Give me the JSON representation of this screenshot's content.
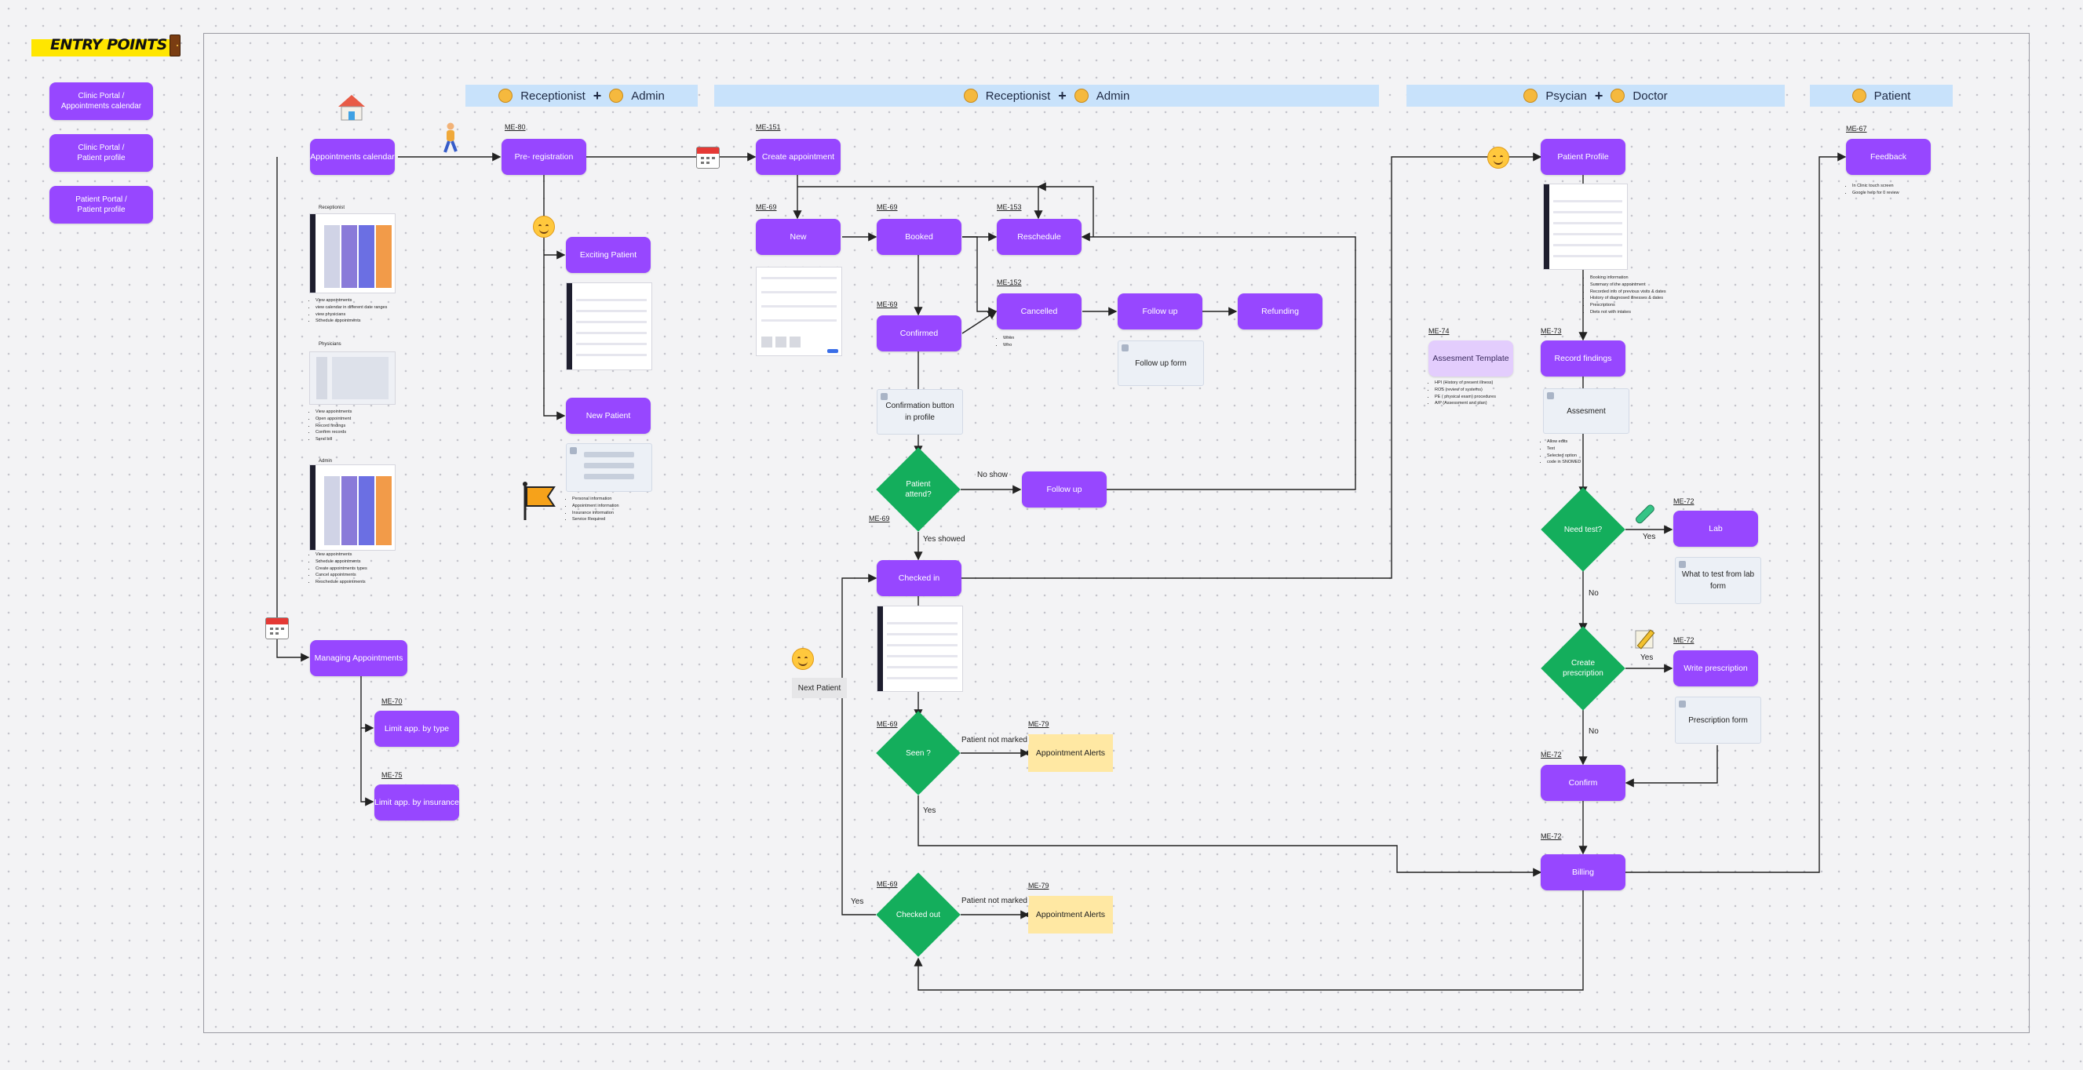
{
  "header": {
    "title": "ENTRY POINTS"
  },
  "entry_points": [
    "Clinic Portal /\nAppointments calendar",
    "Clinic Portal /\nPatient profile",
    "Patient Portal /\nPatient profile"
  ],
  "lanes": {
    "lane1": {
      "a": "Receptionist",
      "b": "Admin"
    },
    "lane2": {
      "a": "Receptionist",
      "b": "Admin"
    },
    "lane3": {
      "a": "Psycian",
      "b": "Doctor"
    },
    "lane4": {
      "a": "Patient"
    }
  },
  "nodes": {
    "appointments_calendar": "Appointments calendar",
    "pre_registration": "Pre- registration",
    "create_appointment": "Create appointment",
    "patient_profile": "Patient Profile",
    "feedback": "Feedback",
    "new": "New",
    "booked": "Booked",
    "reschedule": "Reschedule",
    "existing_patient": "Exciting Patient",
    "new_patient": "New Patient",
    "confirmed": "Confirmed",
    "cancelled": "Cancelled",
    "follow_up_a": "Follow up",
    "refunding": "Refunding",
    "follow_up_b": "Follow up",
    "checked_in": "Checked in",
    "managing_appointments": "Managing Appointments",
    "limit_by_type": "Limit app. by type",
    "limit_by_insurance": "Limit app. by insurance",
    "assessment_template": "Assesment Template",
    "record_findings": "Record findings",
    "lab": "Lab",
    "write_prescription": "Write prescription",
    "confirm": "Confirm",
    "billing": "Billing",
    "appointment_alerts_1": "Appointment Alerts",
    "appointment_alerts_2": "Appointment Alerts",
    "next_patient": "Next Patient"
  },
  "decisions": {
    "patient_attend": "Patient\nattend?",
    "seen": "Seen ?",
    "checked_out": "Checked out",
    "need_test": "Need test?",
    "create_prescription": "Create\nprescription"
  },
  "ids": {
    "me80": "ME-80",
    "me151": "ME-151",
    "me69a": "ME-69",
    "me69b": "ME-69",
    "me153": "ME-153",
    "me152": "ME-152",
    "me69c": "ME-69",
    "me69d": "ME-69",
    "me69e": "ME-69",
    "me79a": "ME-79",
    "me69f": "ME-69",
    "me79b": "ME-79",
    "me70": "ME-70",
    "me75": "ME-75",
    "me67": "ME-67",
    "me74": "ME-74",
    "me73": "ME-73",
    "me72a": "ME-72",
    "me72b": "ME-72",
    "me72c": "ME-72",
    "me72d": "ME-72"
  },
  "edge_labels": {
    "no_show": "No show",
    "yes_showed": "Yes showed",
    "not_marked_1": "Patient not marked",
    "yes_seen": "Yes",
    "not_marked_2": "Patient not marked",
    "yes_out": "Yes",
    "yes_test": "Yes",
    "no_test": "No",
    "yes_presc": "Yes",
    "no_presc": "No"
  },
  "forms": {
    "follow_up_form": "Follow up form",
    "confirmation_button": "Confirmation button\nin profile",
    "assessment": "Assesment",
    "lab_form": "What to test from lab\nform",
    "prescription_form": "Prescription form"
  },
  "notes": {
    "receptionist_title": "Receptionist",
    "receptionist_items": [
      "View appointments",
      "view calendar in different date ranges",
      "view physicians",
      "Schedule appointments"
    ],
    "physicians_title": "Physicians",
    "physicians_items": [
      "View appointments",
      "Open appointment",
      "Record findings",
      "Confirm records",
      "Send bill"
    ],
    "admin_title": "Admin",
    "admin_items": [
      "View appointments",
      "Schedule appointments",
      "Create appointments types",
      "Cancel appointments",
      "Reschedule appointments"
    ],
    "new_patient_items": [
      "Personal information",
      "Appointment information",
      "Insurance information",
      "Service Required"
    ],
    "confirmed_items": [
      "When",
      "Who"
    ],
    "profile_items": [
      "Booking information",
      "Summary of the appointment",
      "Recorded info of previous visits & dates",
      "History of diagnosed illnesses & dates",
      "Prescriptions",
      "Diets not with intakes"
    ],
    "template_items": [
      "HPI (History of present illness)",
      "ROS (review of systems)",
      "PE ( physical exam) procedures",
      "A/P (Assessment and plan)"
    ],
    "assessment_items": [
      "Allow edits",
      "Text",
      "Selected option",
      "code in SNOMED"
    ],
    "feedback_items": [
      "In Clinic touch screen",
      "Google help for 0 review"
    ]
  },
  "colors": {
    "node": "#9747ff",
    "decision": "#14ae5c",
    "alert": "#ffe8a3",
    "lane": "#c8e2fb",
    "title_bg": "#ffe600"
  },
  "icons": [
    "house-icon",
    "walking-person-icon",
    "calendar-icon",
    "smiley-icon",
    "flag-icon",
    "test-tube-icon",
    "pencil-icon"
  ]
}
